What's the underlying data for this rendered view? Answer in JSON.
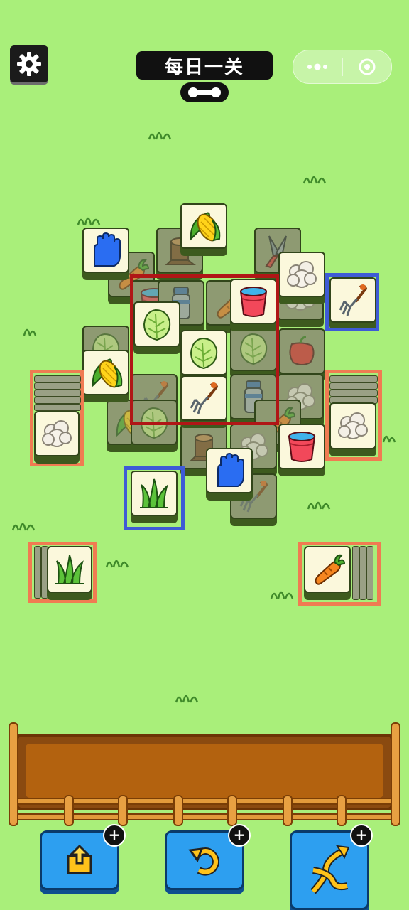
{
  "header": {
    "level_title": "每日一关",
    "settings_icon": "gear-icon",
    "progress_icon": "dumbbell-progress-icon",
    "capsule_menu_icon": "more-dots-icon",
    "capsule_close_icon": "target-close-icon"
  },
  "board": {
    "highlight_colors": {
      "group": "#b01616",
      "single": "#3e5bd6",
      "stack": "#f07b52"
    },
    "items": [
      "glove",
      "corn",
      "stump",
      "pruner",
      "carrot",
      "cauliflower",
      "bucket",
      "thermos",
      "cabbage",
      "fork",
      "grass",
      "bell-pepper"
    ]
  },
  "tray": {
    "slots_filled": 0
  },
  "powerups": [
    {
      "name": "move-out",
      "icon": "box-arrow-icon"
    },
    {
      "name": "undo",
      "icon": "undo-arrow-icon"
    },
    {
      "name": "shuffle",
      "icon": "shuffle-arrows-icon"
    }
  ],
  "plus_label": "+"
}
